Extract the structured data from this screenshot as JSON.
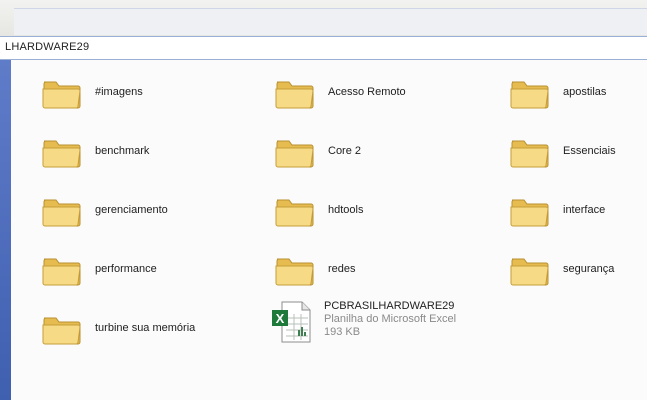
{
  "address": {
    "path": "LHARDWARE29"
  },
  "folders": [
    {
      "label": "#imagens"
    },
    {
      "label": "Acesso Remoto"
    },
    {
      "label": "apostilas"
    },
    {
      "label": "benchmark"
    },
    {
      "label": "Core 2"
    },
    {
      "label": "Essenciais"
    },
    {
      "label": "gerenciamento"
    },
    {
      "label": "hdtools"
    },
    {
      "label": "interface"
    },
    {
      "label": "performance"
    },
    {
      "label": "redes"
    },
    {
      "label": "segurança"
    },
    {
      "label": "turbine sua memória"
    }
  ],
  "file": {
    "name": "PCBRASILHARDWARE29",
    "type": "Planilha do Microsoft Excel",
    "size": "193 KB",
    "icon": "excel-spreadsheet-icon"
  },
  "colors": {
    "folder": "#f1d27a",
    "sidebar": "#4f6fbf",
    "excel_green": "#1d7a3a"
  }
}
